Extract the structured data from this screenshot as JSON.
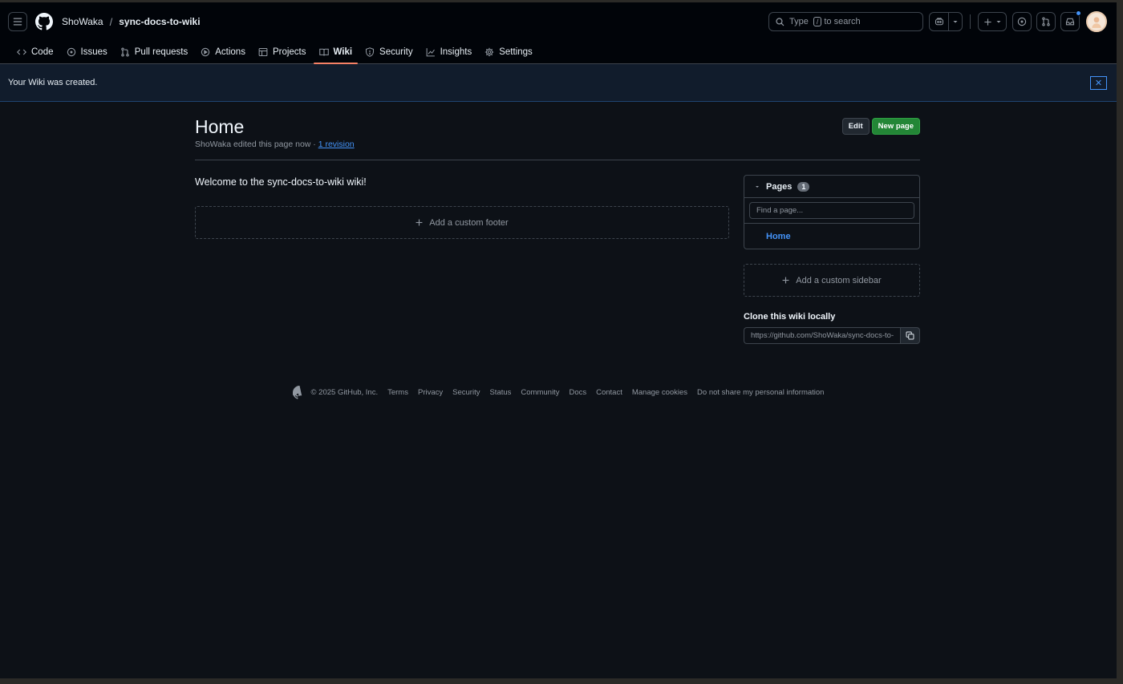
{
  "header": {
    "owner": "ShoWaka",
    "separator": "/",
    "repo": "sync-docs-to-wiki",
    "search": {
      "prefix": "Type",
      "key": "/",
      "suffix": "to search"
    },
    "icons": [
      "menu-icon",
      "github-logo-icon",
      "search-icon",
      "copilot-icon",
      "plus-icon",
      "issue-opened-icon",
      "pull-request-icon",
      "inbox-icon"
    ],
    "notification_dot_color": "#4493f8"
  },
  "tabs": [
    {
      "label": "Code",
      "icon": "code-icon"
    },
    {
      "label": "Issues",
      "icon": "issue-opened-icon"
    },
    {
      "label": "Pull requests",
      "icon": "pull-request-icon"
    },
    {
      "label": "Actions",
      "icon": "play-icon"
    },
    {
      "label": "Projects",
      "icon": "table-icon"
    },
    {
      "label": "Wiki",
      "icon": "book-icon",
      "active": true
    },
    {
      "label": "Security",
      "icon": "shield-icon"
    },
    {
      "label": "Insights",
      "icon": "graph-icon"
    },
    {
      "label": "Settings",
      "icon": "gear-icon"
    }
  ],
  "flash": {
    "message": "Your Wiki was created.",
    "close_glyph": "✕"
  },
  "page": {
    "title": "Home",
    "meta_text": "ShoWaka edited this page now · ",
    "revision_link": "1 revision",
    "edit_label": "Edit",
    "new_page_label": "New page",
    "welcome": "Welcome to the sync-docs-to-wiki wiki!",
    "add_footer": "Add a custom footer"
  },
  "sidebar": {
    "pages_label": "Pages",
    "pages_count": "1",
    "find_placeholder": "Find a page...",
    "pages": [
      "Home"
    ],
    "add_sidebar": "Add a custom sidebar",
    "clone_title": "Clone this wiki locally",
    "clone_url": "https://github.com/ShoWaka/sync-docs-to-wiki.wiki.git"
  },
  "footer": {
    "copyright": "© 2025 GitHub, Inc.",
    "links": [
      "Terms",
      "Privacy",
      "Security",
      "Status",
      "Community",
      "Docs",
      "Contact",
      "Manage cookies",
      "Do not share my personal information"
    ]
  },
  "colors": {
    "background": "#0d1117",
    "header": "#010409",
    "accent_link": "#4493f8",
    "primary_button": "#238636",
    "active_tab_underline": "#f78166"
  }
}
